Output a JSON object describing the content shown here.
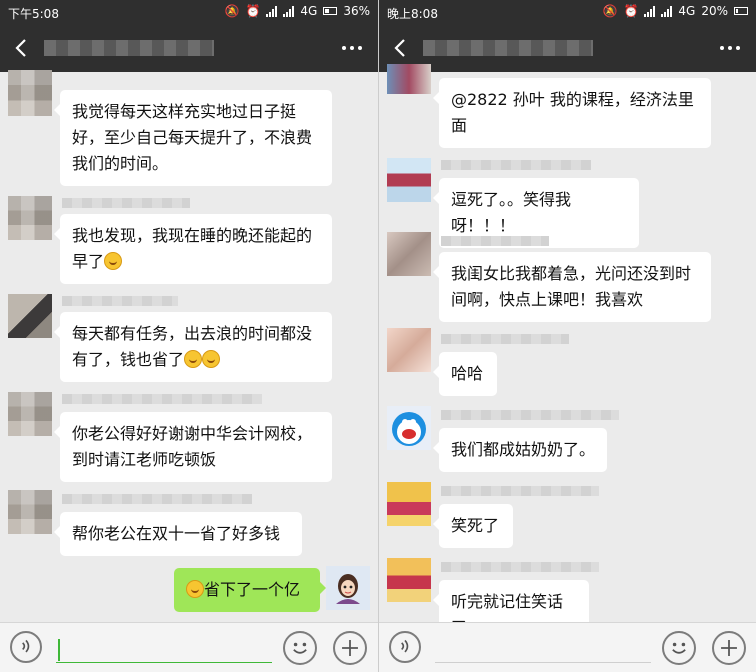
{
  "left": {
    "status": {
      "time": "下午5:08",
      "network": "4G",
      "battery": "36%",
      "battery_level": 0.36
    },
    "messages": [
      {
        "text": "我觉得每天这样充实地过日子挺\n好，至少自己每天提升了，不浪费\n我们的时间。"
      },
      {
        "text": "我也发现，我现在睡的晚还能起的\n早了"
      },
      {
        "text": "每天都有任务，出去浪的时间都没\n有了，钱也省了"
      },
      {
        "text": "你老公得好好谢谢中华会计网校，\n到时请江老师吃顿饭"
      },
      {
        "text": "帮你老公在双十一省了好多钱"
      }
    ],
    "my_message": {
      "text": "省下了一个亿"
    }
  },
  "right": {
    "status": {
      "time": "晚上8:08",
      "network": "4G",
      "battery": "20%",
      "battery_level": 0.2
    },
    "messages": [
      {
        "text": "@2822 孙叶  我的课程，经济法里\n面"
      },
      {
        "text": "逗死了。。笑得我呀！！！"
      },
      {
        "text": "我闺女比我都着急，光问还没到时\n间啊，快点上课吧！我喜欢"
      },
      {
        "text": "哈哈"
      },
      {
        "text": "我们都成姑奶奶了。"
      },
      {
        "text": "笑死了"
      },
      {
        "text": "听完就记住笑话了"
      }
    ]
  },
  "icons": {
    "back": "chevron-left-icon",
    "more": "more-dots-icon",
    "voice": "voice-icon",
    "emoji": "emoji-icon",
    "add": "plus-icon"
  },
  "colors": {
    "bar": "#2f2f2f",
    "chat_bg": "#ebebeb",
    "my_bubble": "#9fe658",
    "input_line": "#3fb838"
  }
}
